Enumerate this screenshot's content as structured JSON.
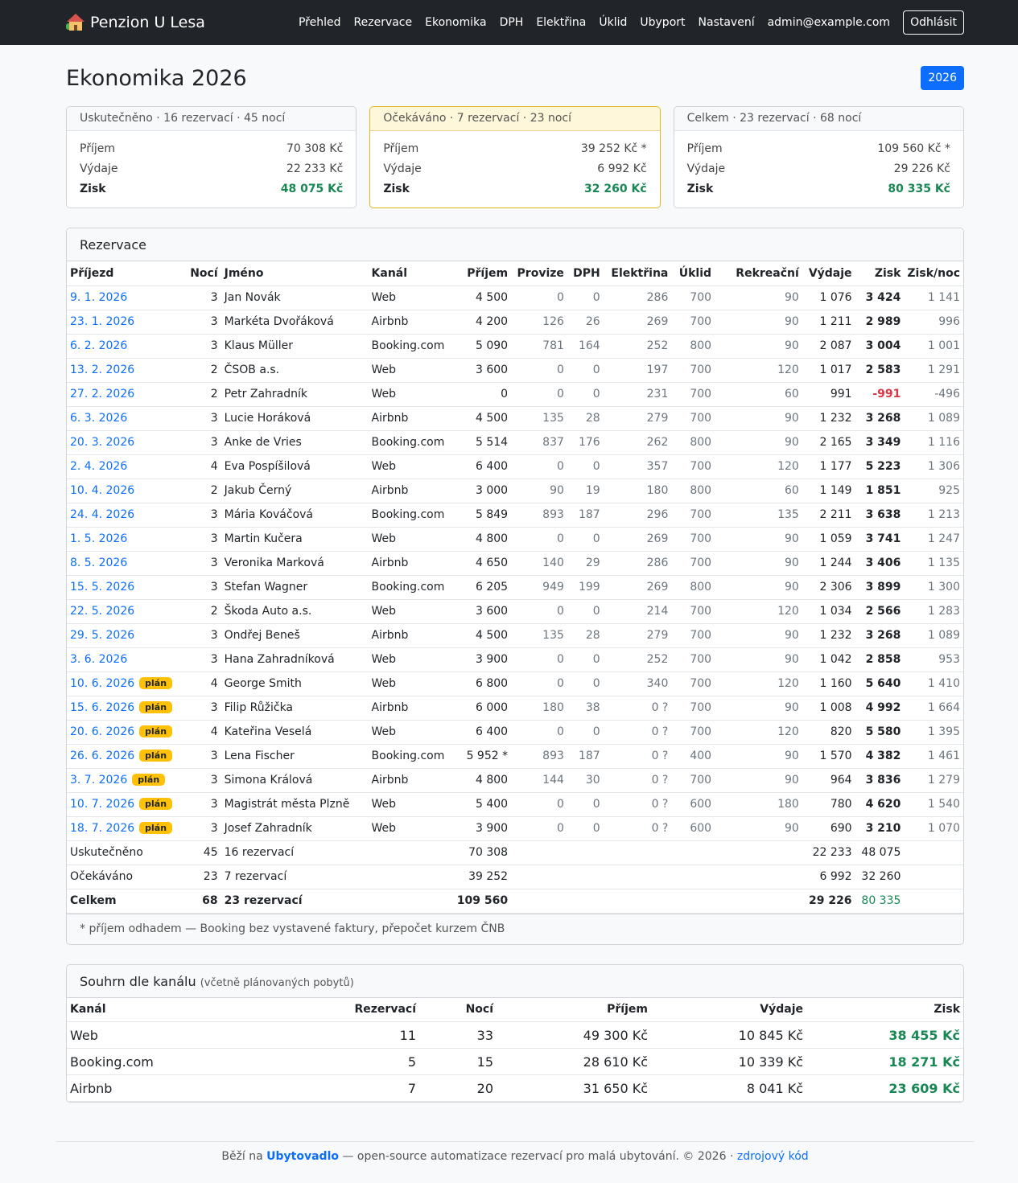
{
  "nav": {
    "brand": "Penzion U Lesa",
    "links": [
      "Přehled",
      "Rezervace",
      "Ekonomika",
      "DPH",
      "Elektřina",
      "Úklid",
      "Ubyport",
      "Nastavení"
    ],
    "user": "admin@example.com",
    "logout": "Odhlásit"
  },
  "page": {
    "title": "Ekonomika 2026",
    "year_button": "2026"
  },
  "summary": [
    {
      "head": "Uskutečněno · 16 rezervací · 45 nocí",
      "income_label": "Příjem",
      "income": "70 308 Kč",
      "expense_label": "Výdaje",
      "expense": "22 233 Kč",
      "profit_label": "Zisk",
      "profit": "48 075 Kč"
    },
    {
      "head": "Očekáváno · 7 rezervací · 23 nocí",
      "income_label": "Příjem",
      "income": "39 252 Kč *",
      "expense_label": "Výdaje",
      "expense": "6 992 Kč",
      "profit_label": "Zisk",
      "profit": "32 260 Kč"
    },
    {
      "head": "Celkem · 23 rezervací · 68 nocí",
      "income_label": "Příjem",
      "income": "109 560 Kč *",
      "expense_label": "Výdaje",
      "expense": "29 226 Kč",
      "profit_label": "Zisk",
      "profit": "80 335 Kč"
    }
  ],
  "reservations": {
    "title": "Rezervace",
    "columns": [
      "Příjezd",
      "Nocí",
      "Jméno",
      "Kanál",
      "Příjem",
      "Provize",
      "DPH",
      "Elektřina",
      "Úklid",
      "Rekreační",
      "Výdaje",
      "Zisk",
      "Zisk/noc"
    ],
    "rows": [
      [
        "9. 1. 2026",
        "",
        "3",
        "Jan Novák",
        "Web",
        "4 500",
        "0",
        "0",
        "286",
        "700",
        "90",
        "1 076",
        "3 424",
        "1 141"
      ],
      [
        "23. 1. 2026",
        "",
        "3",
        "Markéta Dvořáková",
        "Airbnb",
        "4 200",
        "126",
        "26",
        "269",
        "700",
        "90",
        "1 211",
        "2 989",
        "996"
      ],
      [
        "6. 2. 2026",
        "",
        "3",
        "Klaus Müller",
        "Booking.com",
        "5 090",
        "781",
        "164",
        "252",
        "800",
        "90",
        "2 087",
        "3 004",
        "1 001"
      ],
      [
        "13. 2. 2026",
        "",
        "2",
        "ČSOB a.s.",
        "Web",
        "3 600",
        "0",
        "0",
        "197",
        "700",
        "120",
        "1 017",
        "2 583",
        "1 291"
      ],
      [
        "27. 2. 2026",
        "",
        "2",
        "Petr Zahradník",
        "Web",
        "0",
        "0",
        "0",
        "231",
        "700",
        "60",
        "991",
        "-991",
        "-496"
      ],
      [
        "6. 3. 2026",
        "",
        "3",
        "Lucie Horáková",
        "Airbnb",
        "4 500",
        "135",
        "28",
        "279",
        "700",
        "90",
        "1 232",
        "3 268",
        "1 089"
      ],
      [
        "20. 3. 2026",
        "",
        "3",
        "Anke de Vries",
        "Booking.com",
        "5 514",
        "837",
        "176",
        "262",
        "800",
        "90",
        "2 165",
        "3 349",
        "1 116"
      ],
      [
        "2. 4. 2026",
        "",
        "4",
        "Eva Pospíšilová",
        "Web",
        "6 400",
        "0",
        "0",
        "357",
        "700",
        "120",
        "1 177",
        "5 223",
        "1 306"
      ],
      [
        "10. 4. 2026",
        "",
        "2",
        "Jakub Černý",
        "Airbnb",
        "3 000",
        "90",
        "19",
        "180",
        "800",
        "60",
        "1 149",
        "1 851",
        "925"
      ],
      [
        "24. 4. 2026",
        "",
        "3",
        "Mária Kováčová",
        "Booking.com",
        "5 849",
        "893",
        "187",
        "296",
        "700",
        "135",
        "2 211",
        "3 638",
        "1 213"
      ],
      [
        "1. 5. 2026",
        "",
        "3",
        "Martin Kučera",
        "Web",
        "4 800",
        "0",
        "0",
        "269",
        "700",
        "90",
        "1 059",
        "3 741",
        "1 247"
      ],
      [
        "8. 5. 2026",
        "",
        "3",
        "Veronika Marková",
        "Airbnb",
        "4 650",
        "140",
        "29",
        "286",
        "700",
        "90",
        "1 244",
        "3 406",
        "1 135"
      ],
      [
        "15. 5. 2026",
        "",
        "3",
        "Stefan Wagner",
        "Booking.com",
        "6 205",
        "949",
        "199",
        "269",
        "800",
        "90",
        "2 306",
        "3 899",
        "1 300"
      ],
      [
        "22. 5. 2026",
        "",
        "2",
        "Škoda Auto a.s.",
        "Web",
        "3 600",
        "0",
        "0",
        "214",
        "700",
        "120",
        "1 034",
        "2 566",
        "1 283"
      ],
      [
        "29. 5. 2026",
        "",
        "3",
        "Ondřej Beneš",
        "Airbnb",
        "4 500",
        "135",
        "28",
        "279",
        "700",
        "90",
        "1 232",
        "3 268",
        "1 089"
      ],
      [
        "3. 6. 2026",
        "",
        "3",
        "Hana Zahradníková",
        "Web",
        "3 900",
        "0",
        "0",
        "252",
        "700",
        "90",
        "1 042",
        "2 858",
        "953"
      ],
      [
        "10. 6. 2026",
        "plán",
        "4",
        "George Smith",
        "Web",
        "6 800",
        "0",
        "0",
        "340",
        "700",
        "120",
        "1 160",
        "5 640",
        "1 410"
      ],
      [
        "15. 6. 2026",
        "plán",
        "3",
        "Filip Růžička",
        "Airbnb",
        "6 000",
        "180",
        "38",
        "0 ?",
        "700",
        "90",
        "1 008",
        "4 992",
        "1 664"
      ],
      [
        "20. 6. 2026",
        "plán",
        "4",
        "Kateřina Veselá",
        "Web",
        "6 400",
        "0",
        "0",
        "0 ?",
        "700",
        "120",
        "820",
        "5 580",
        "1 395"
      ],
      [
        "26. 6. 2026",
        "plán",
        "3",
        "Lena Fischer",
        "Booking.com",
        "5 952 *",
        "893",
        "187",
        "0 ?",
        "400",
        "90",
        "1 570",
        "4 382",
        "1 461"
      ],
      [
        "3. 7. 2026",
        "plán",
        "3",
        "Simona Králová",
        "Airbnb",
        "4 800",
        "144",
        "30",
        "0 ?",
        "700",
        "90",
        "964",
        "3 836",
        "1 279"
      ],
      [
        "10. 7. 2026",
        "plán",
        "3",
        "Magistrát města Plzně",
        "Web",
        "5 400",
        "0",
        "0",
        "0 ?",
        "600",
        "180",
        "780",
        "4 620",
        "1 540"
      ],
      [
        "18. 7. 2026",
        "plán",
        "3",
        "Josef Zahradník",
        "Web",
        "3 900",
        "0",
        "0",
        "0 ?",
        "600",
        "90",
        "690",
        "3 210",
        "1 070"
      ]
    ],
    "totals": [
      {
        "label": "Uskutečněno",
        "nights": "45",
        "count": "16 rezervací",
        "income": "70 308",
        "expense": "22 233",
        "profit": "48 075"
      },
      {
        "label": "Očekáváno",
        "nights": "23",
        "count": "7 rezervací",
        "income": "39 252",
        "expense": "6 992",
        "profit": "32 260"
      },
      {
        "label": "Celkem",
        "nights": "68",
        "count": "23 rezervací",
        "income": "109 560",
        "expense": "29 226",
        "profit": "80 335"
      }
    ],
    "footnote": "* příjem odhadem — Booking bez vystavené faktury, přepočet kurzem ČNB"
  },
  "channels": {
    "title": "Souhrn dle kanálu",
    "subtitle": "(včetně plánovaných pobytů)",
    "columns": [
      "Kanál",
      "Rezervací",
      "Nocí",
      "Příjem",
      "Výdaje",
      "Zisk"
    ],
    "rows": [
      [
        "Web",
        "11",
        "33",
        "49 300 Kč",
        "10 845 Kč",
        "38 455 Kč"
      ],
      [
        "Booking.com",
        "5",
        "15",
        "28 610 Kč",
        "10 339 Kč",
        "18 271 Kč"
      ],
      [
        "Airbnb",
        "7",
        "20",
        "31 650 Kč",
        "8 041 Kč",
        "23 609 Kč"
      ]
    ]
  },
  "footer": {
    "prefix": "Běží na",
    "project": "Ubytovadlo",
    "text": "— open-source automatizace rezervací pro malá ubytování. © 2026 ·",
    "source_link": "zdrojový kód"
  },
  "colors": {
    "navbar": "#212529",
    "accent": "#0d6efd",
    "profit": "#198754",
    "loss": "#dc3545",
    "plan_badge": "#ffc107"
  }
}
